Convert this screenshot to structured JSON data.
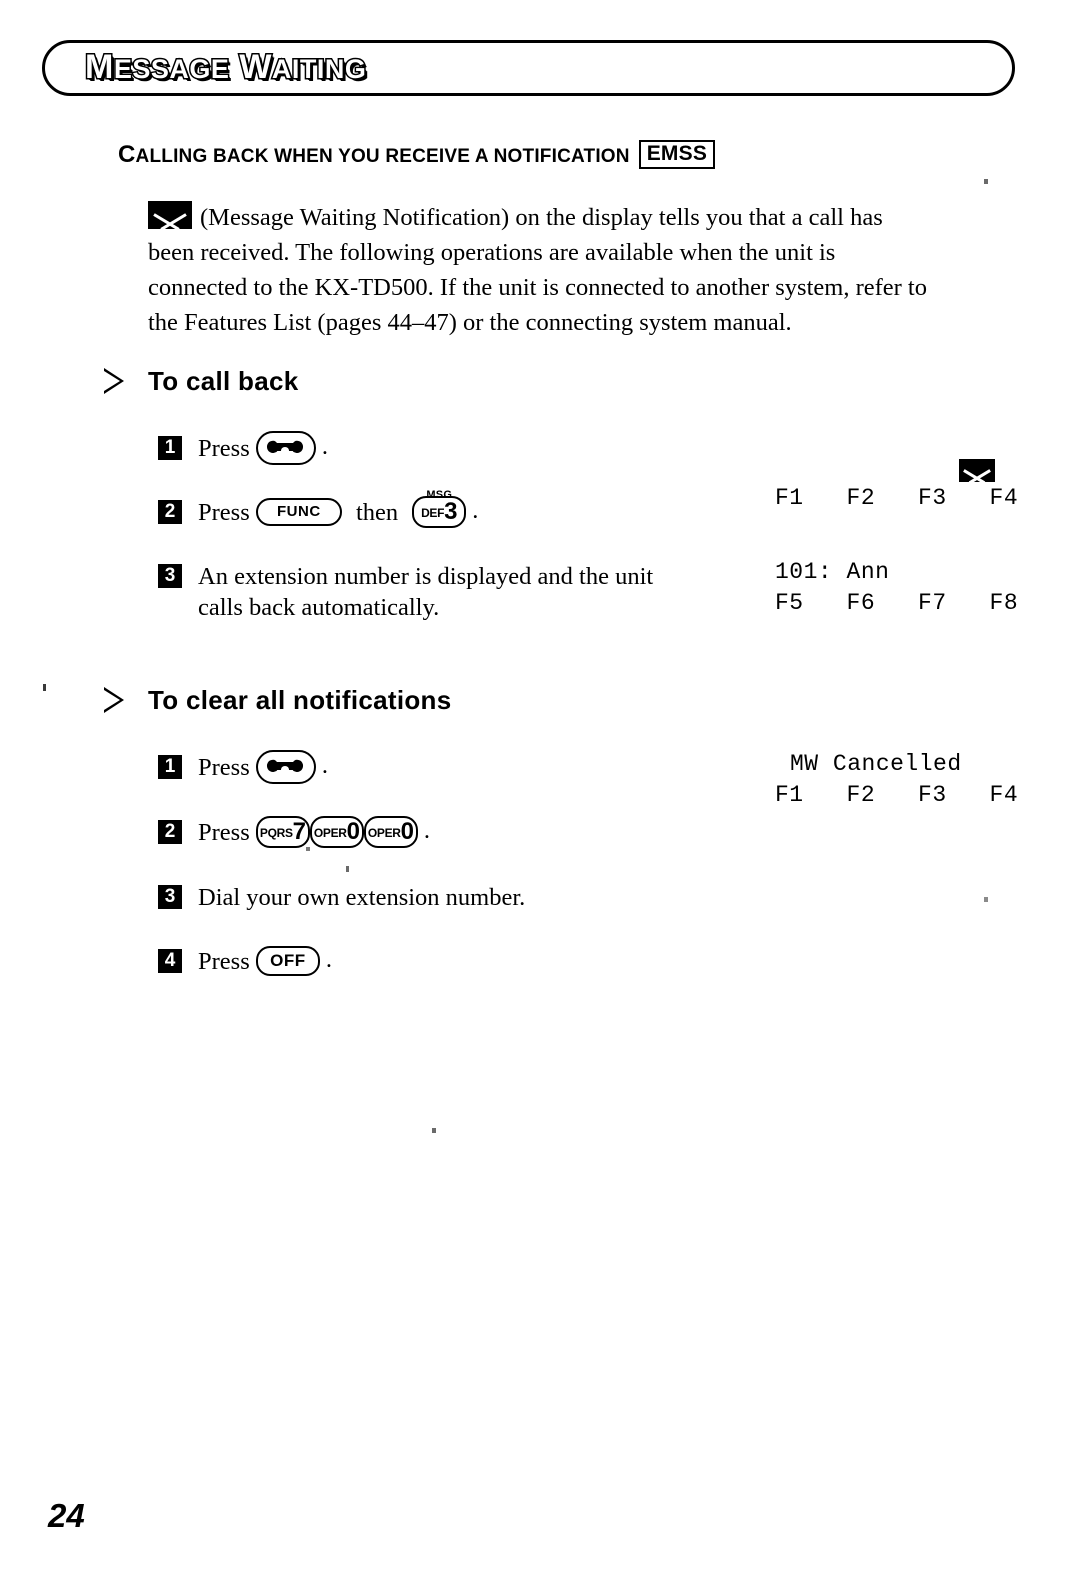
{
  "banner": {
    "title_words": [
      {
        "cap": "M",
        "rest": "ESSAGE"
      },
      {
        "cap": "W",
        "rest": "AITING"
      }
    ],
    "title_plain": "MESSAGE WAITING"
  },
  "section": {
    "heading_cap": "C",
    "heading_rest": "ALLING BACK WHEN YOU RECEIVE A NOTIFICATION",
    "heading_plain": "CALLING BACK WHEN YOU RECEIVE A NOTIFICATION",
    "tag": "EMSS"
  },
  "intro": {
    "icon": "envelope-icon",
    "lines": [
      "(Message Waiting Notification) on the display tells you that a call has",
      "been received. The following operations are available when the unit is",
      "connected to the KX-TD500. If the unit is connected to another system, refer to",
      "the Features List (pages 44–47) or the connecting system manual."
    ]
  },
  "procedures": [
    {
      "id": "to-call-back",
      "heading": "To call back",
      "steps": [
        {
          "num": "1",
          "prefix": "Press",
          "keys": [
            {
              "type": "phone",
              "label": ""
            }
          ],
          "suffix": ".",
          "text": ""
        },
        {
          "num": "2",
          "prefix": "Press",
          "keys": [
            {
              "type": "wide",
              "label": "FUNC"
            },
            {
              "type": "joiner",
              "label": "then"
            },
            {
              "type": "dial",
              "label": "DEF",
              "digit": "3",
              "sup": "MSG"
            }
          ],
          "suffix": ".",
          "text": ""
        },
        {
          "num": "3",
          "prefix": "",
          "keys": [],
          "suffix": "",
          "text": "An extension number is displayed and the unit",
          "text2": "calls back automatically."
        }
      ]
    },
    {
      "id": "to-clear-all-notifications",
      "heading": "To clear all notifications",
      "steps": [
        {
          "num": "1",
          "prefix": "Press",
          "keys": [
            {
              "type": "phone",
              "label": ""
            }
          ],
          "suffix": ".",
          "text": ""
        },
        {
          "num": "2",
          "prefix": "Press",
          "keys": [
            {
              "type": "dial",
              "label": "PQRS",
              "digit": "7",
              "sup": ""
            },
            {
              "type": "dial",
              "label": "OPER",
              "digit": "0",
              "sup": ""
            },
            {
              "type": "dial",
              "label": "OPER",
              "digit": "0",
              "sup": ""
            }
          ],
          "suffix": ".",
          "text": ""
        },
        {
          "num": "3",
          "prefix": "",
          "keys": [],
          "suffix": "",
          "text": "Dial your own extension number."
        },
        {
          "num": "4",
          "prefix": "Press",
          "keys": [
            {
              "type": "off",
              "label": "OFF"
            }
          ],
          "suffix": ".",
          "text": ""
        }
      ]
    }
  ],
  "displays": {
    "call_back": {
      "icon": "envelope-icon",
      "fkeys_top": "F1   F2   F3   F4",
      "line_extension": "101: Ann",
      "fkeys_bottom": "F5   F6   F7   F8"
    },
    "clear_all": {
      "line_status": "MW Cancelled",
      "fkeys": "F1   F2   F3   F4"
    }
  },
  "footer": {
    "page_number": "24"
  },
  "keycap_labels": {
    "func": "FUNC",
    "off": "OFF",
    "then": "then",
    "msg": "MSG",
    "def": "DEF",
    "three": "3",
    "pqrs": "PQRS",
    "seven": "7",
    "oper": "OPER",
    "zero": "0"
  },
  "press_label": "Press",
  "colors": {
    "ink": "#000000",
    "paper": "#ffffff"
  }
}
